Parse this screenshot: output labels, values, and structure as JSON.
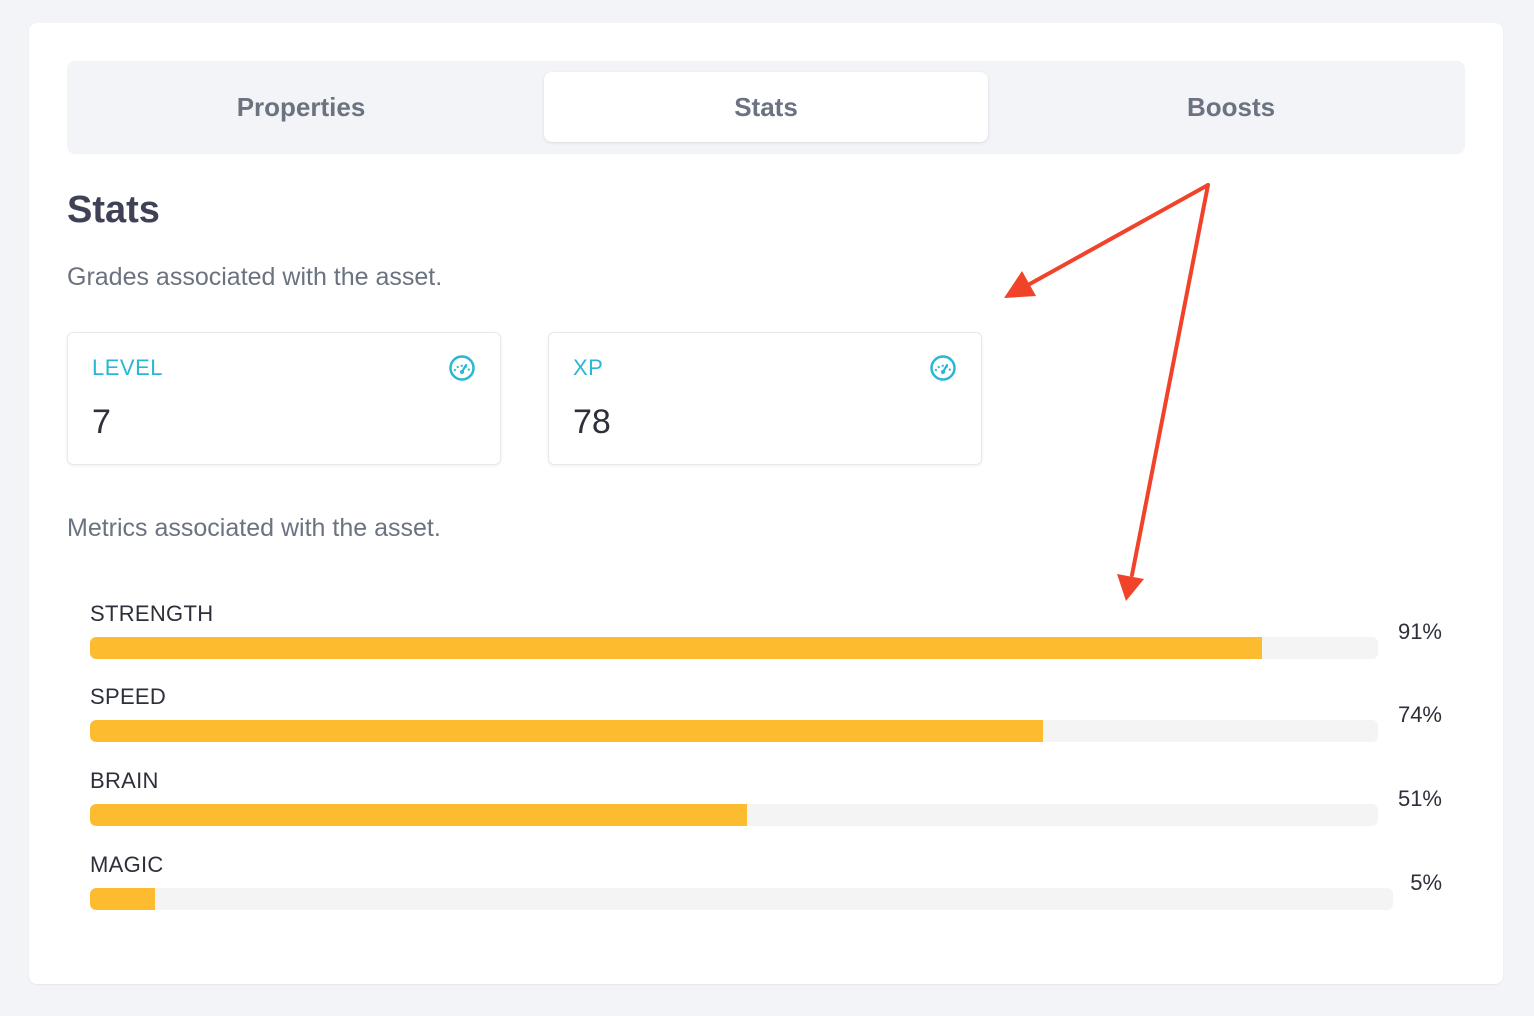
{
  "tabs": [
    {
      "label": "Properties",
      "active": false
    },
    {
      "label": "Stats",
      "active": true
    },
    {
      "label": "Boosts",
      "active": false
    }
  ],
  "section": {
    "title": "Stats",
    "grades_subtitle": "Grades associated with the asset.",
    "metrics_subtitle": "Metrics associated with the asset."
  },
  "grades": [
    {
      "label": "LEVEL",
      "value": "7",
      "icon": "gauge-icon"
    },
    {
      "label": "XP",
      "value": "78",
      "icon": "gauge-icon"
    }
  ],
  "metrics": [
    {
      "label": "STRENGTH",
      "percent_text": "91%",
      "fill": 0.91
    },
    {
      "label": "SPEED",
      "percent_text": "74%",
      "fill": 0.74
    },
    {
      "label": "BRAIN",
      "percent_text": "51%",
      "fill": 0.51
    },
    {
      "label": "MAGIC",
      "percent_text": "5%",
      "fill": 0.05
    }
  ],
  "colors": {
    "accent": "#2ab7d6",
    "bar_fill": "#fdbb30",
    "bar_track": "#f4f4f5",
    "annotation_arrow": "#f0432a"
  }
}
